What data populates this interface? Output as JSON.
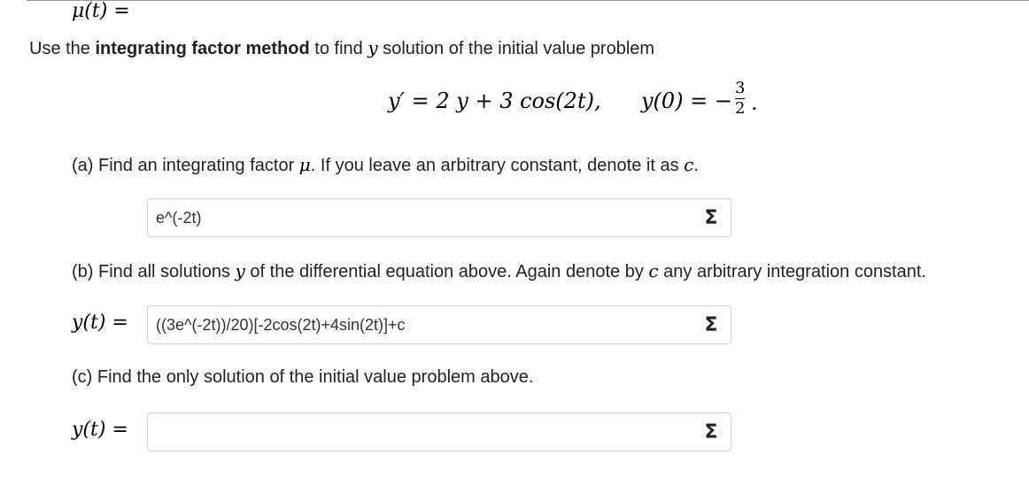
{
  "intro": {
    "prefix": "Use the ",
    "bold": "integrating factor method",
    "middle": " to find ",
    "var": "y",
    "suffix": " solution of the initial value problem"
  },
  "equation": {
    "lhs1": "y′ = 2 y + 3 cos(2t),",
    "lhs2": "y(0) = −",
    "frac_num": "3",
    "frac_den": "2",
    "period": "."
  },
  "parts": {
    "a": {
      "question_prefix": "(a) Find an integrating factor ",
      "question_var": "μ",
      "question_suffix": ". If you leave an arbitrary constant, denote it as ",
      "question_const": "c",
      "question_end": ".",
      "label": "μ(t) =",
      "answer": "e^(-2t)",
      "sigma": "Σ"
    },
    "b": {
      "question_prefix": "(b) Find all solutions ",
      "question_var": "y",
      "question_suffix": " of the differential equation above. Again denote by ",
      "question_const": "c",
      "question_end": " any arbitrary integration constant.",
      "label": "y(t) =",
      "answer": "((3e^(-2t))/20)[-2cos(2t)+4sin(2t)]+c",
      "sigma": "Σ"
    },
    "c": {
      "question": "(c) Find the only solution of the initial value problem above.",
      "label": "y(t) =",
      "answer": "",
      "sigma": "Σ"
    }
  }
}
